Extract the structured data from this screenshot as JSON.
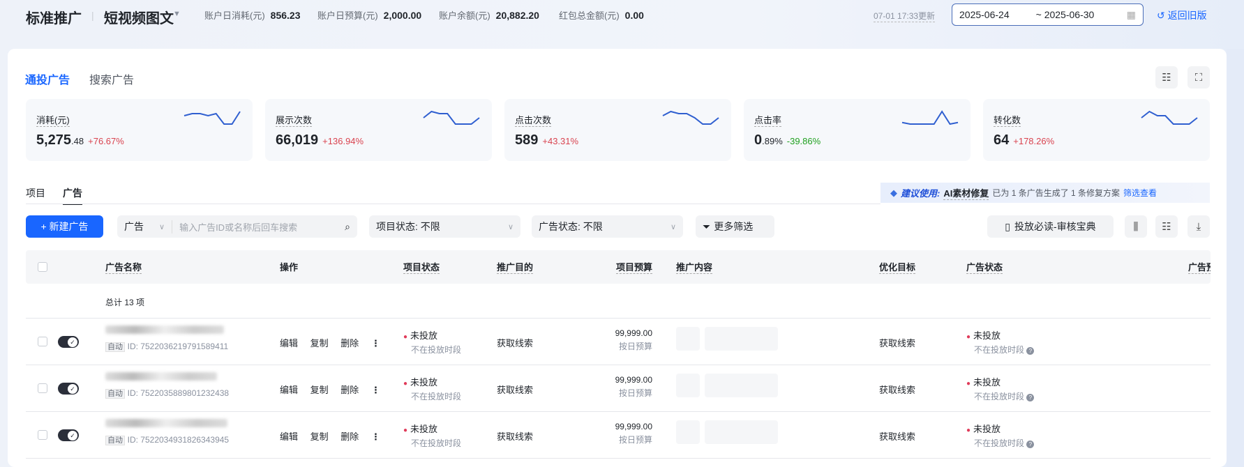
{
  "header": {
    "title": "标准推广",
    "subtitle": "短视频图文",
    "stats": [
      {
        "label": "账户日消耗(元)",
        "value": "856.23"
      },
      {
        "label": "账户日预算(元)",
        "value": "2,000.00"
      },
      {
        "label": "账户余额(元)",
        "value": "20,882.20"
      },
      {
        "label": "红包总金额(元)",
        "value": "0.00"
      }
    ],
    "updated": "07-01 17:33更新",
    "date_start": "2025-06-24",
    "date_end": "~ 2025-06-30",
    "back_label": "返回旧版"
  },
  "tabs": [
    {
      "label": "通投广告",
      "active": true
    },
    {
      "label": "搜索广告",
      "active": false
    }
  ],
  "metrics": [
    {
      "label": "消耗(元)",
      "value_int": "5,275",
      "value_dec": ".48",
      "change": "+76.67%",
      "trend": [
        6,
        7,
        7,
        6,
        7,
        2,
        2,
        8
      ]
    },
    {
      "label": "展示次数",
      "value_int": "66,019",
      "value_dec": "",
      "change": "+136.94%",
      "trend": [
        5,
        8,
        7,
        7,
        2,
        2,
        2,
        5
      ]
    },
    {
      "label": "点击次数",
      "value_int": "589",
      "value_dec": "",
      "change": "+43.31%",
      "trend": [
        6,
        8,
        7,
        7,
        5,
        2,
        2,
        5
      ]
    },
    {
      "label": "点击率",
      "value_int": "0",
      "value_dec": ".89%",
      "change": "-39.86%",
      "trend": [
        2,
        1,
        1,
        1,
        1,
        9,
        1,
        2
      ]
    },
    {
      "label": "转化数",
      "value_int": "64",
      "value_dec": "",
      "change": "+178.26%",
      "trend": [
        5,
        8,
        6,
        6,
        2,
        2,
        2,
        5
      ]
    }
  ],
  "colors": {
    "up": "#d9434f",
    "down": "#1fa01f",
    "accent": "#1966ff",
    "line": "#2f5fd0"
  },
  "subtabs": [
    "项目",
    "广告"
  ],
  "ai_banner": {
    "prefix": "建议使用:",
    "name": "AI素材修复",
    "text": "已为 1 条广告生成了 1 条修复方案",
    "link": "筛选查看"
  },
  "toolbar": {
    "new_label": "+ 新建广告",
    "search_type": "广告",
    "search_placeholder": "输入广告ID或名称后回车搜索",
    "project_status": "项目状态:  不限",
    "ad_status": "广告状态:  不限",
    "more_filter": "更多筛选",
    "guide": "投放必读-审核宝典"
  },
  "table": {
    "headers": [
      "广告名称",
      "操作",
      "项目状态",
      "推广目的",
      "项目预算",
      "推广内容",
      "优化目标",
      "广告状态",
      "广告预"
    ],
    "total": "总计 13 项",
    "ops": [
      "编辑",
      "复制",
      "删除"
    ],
    "rows": [
      {
        "tag": "自动",
        "id": "ID: 7522036219791589411",
        "project_status": "未投放",
        "project_sub": "不在投放时段",
        "purpose": "获取线索",
        "budget": "99,999.00",
        "budget_type": "按日预算",
        "goal": "获取线索",
        "ad_status": "未投放",
        "ad_sub": "不在投放时段"
      },
      {
        "tag": "自动",
        "id": "ID: 7522035889801232438",
        "project_status": "未投放",
        "project_sub": "不在投放时段",
        "purpose": "获取线索",
        "budget": "99,999.00",
        "budget_type": "按日预算",
        "goal": "获取线索",
        "ad_status": "未投放",
        "ad_sub": "不在投放时段"
      },
      {
        "tag": "自动",
        "id": "ID: 7522034931826343945",
        "project_status": "未投放",
        "project_sub": "不在投放时段",
        "purpose": "获取线索",
        "budget": "99,999.00",
        "budget_type": "按日预算",
        "goal": "获取线索",
        "ad_status": "未投放",
        "ad_sub": "不在投放时段"
      }
    ]
  }
}
